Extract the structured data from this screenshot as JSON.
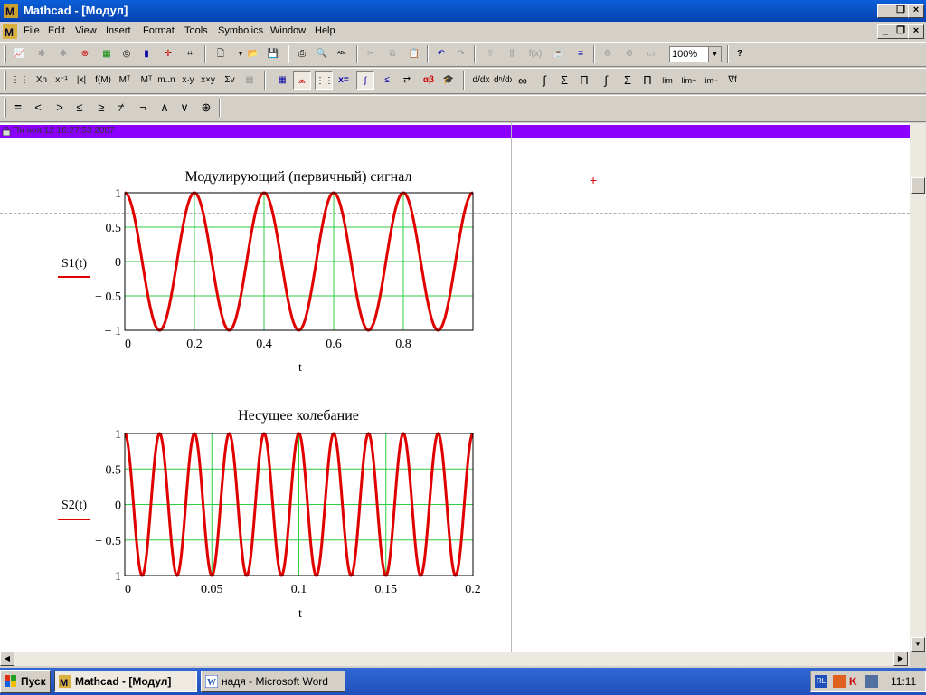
{
  "window": {
    "title": "Mathcad - [Модул]"
  },
  "menu": [
    "File",
    "Edit",
    "View",
    "Insert",
    "Format",
    "Tools",
    "Symbolics",
    "Window",
    "Help"
  ],
  "toolbar_math": {
    "zoom": "100%"
  },
  "palette_labels": {
    "subscript": "Xn",
    "inverse": "x⁻¹",
    "abs": "|x|",
    "vectorize": "f(M)",
    "superscript": "Mᵀ",
    "transpose": "Mᵀ",
    "range": "m..n",
    "dot": "x·y",
    "cross": "x×y",
    "sum_v": "Σv",
    "deriv": "d/dx",
    "nderiv": "dⁿ/dxⁿ",
    "inf": "∞",
    "integral_def": "∫",
    "sum": "Σ",
    "prod": "Π",
    "integral": "∫",
    "sum2": "Σ",
    "prod2": "Π",
    "lim": "lim",
    "lim_plus": "lim+",
    "lim_minus": "lim−",
    "nabla": "∇f",
    "eq_assign": "x=",
    "alpha_beta": "αβ"
  },
  "bool_toolbar": [
    "=",
    "<",
    ">",
    "≤",
    "≥",
    "≠",
    "¬",
    "∧",
    "∨",
    "⊕"
  ],
  "header": {
    "text": "Пн ноя 12 16:27:53 2007"
  },
  "charts_text": {
    "plot1": {
      "title": "Модулирующий (первичный) сигнал",
      "ylabel": "S1(t)",
      "xlabel": "t"
    },
    "plot2": {
      "title": "Несущее колебание",
      "ylabel": "S2(t)",
      "xlabel": "t"
    }
  },
  "chart_data": [
    {
      "type": "line",
      "title": "Модулирующий (первичный) сигнал",
      "xlabel": "t",
      "ylabel": "S1(t)",
      "xlim": [
        0,
        1
      ],
      "ylim": [
        -1,
        1
      ],
      "xticks": [
        0,
        0.2,
        0.4,
        0.6,
        0.8
      ],
      "xtick_labels": [
        "0",
        "0.2",
        "0.4",
        "0.6",
        "0.8"
      ],
      "yticks": [
        1,
        0.5,
        0,
        -0.5,
        -1
      ],
      "ytick_labels": [
        "1",
        "0.5",
        "0",
        "− 0.5",
        "− 1"
      ],
      "grid": true,
      "series": [
        {
          "function": "cos(2π·5·t)",
          "frequency": 5,
          "color": "#e00000"
        }
      ]
    },
    {
      "type": "line",
      "title": "Несущее колебание",
      "xlabel": "t",
      "ylabel": "S2(t)",
      "xlim": [
        0,
        0.2
      ],
      "ylim": [
        -1,
        1
      ],
      "xticks": [
        0,
        0.05,
        0.1,
        0.15,
        0.2
      ],
      "xtick_labels": [
        "0",
        "0.05",
        "0.1",
        "0.15",
        "0.2"
      ],
      "yticks": [
        1,
        0.5,
        0,
        -0.5,
        -1
      ],
      "ytick_labels": [
        "1",
        "0.5",
        "0",
        "− 0.5",
        "− 1"
      ],
      "grid": true,
      "series": [
        {
          "function": "cos(2π·50·t)",
          "frequency": 50,
          "color": "#e00000"
        }
      ]
    }
  ],
  "taskbar": {
    "start": "Пуск",
    "tasks": [
      "Mathcad - [Модул]",
      "надя - Microsoft Word"
    ],
    "lang": "RL",
    "clock": "11:11"
  }
}
